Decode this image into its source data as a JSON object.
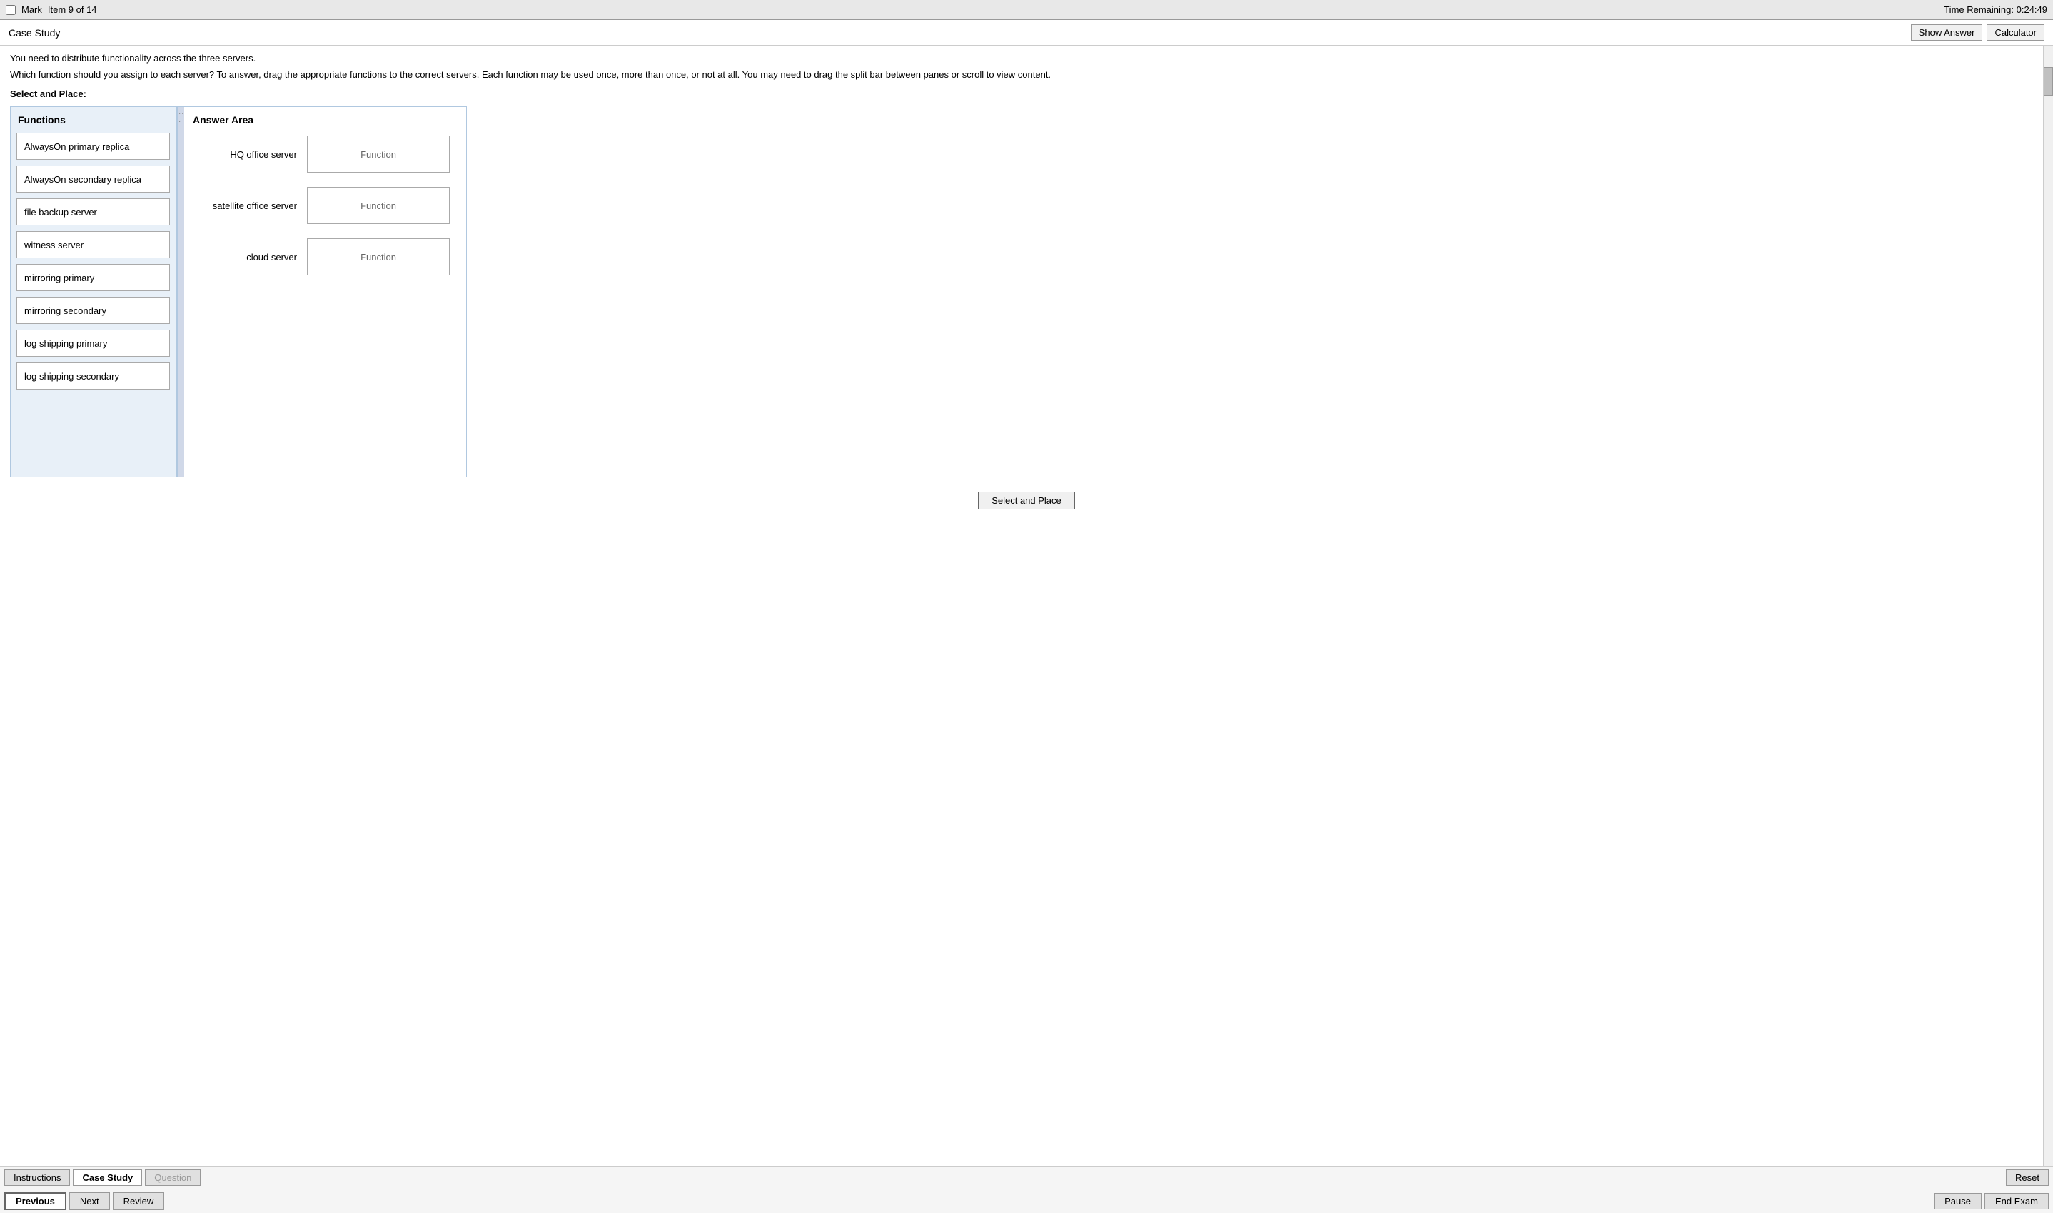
{
  "topBar": {
    "markLabel": "Mark",
    "itemInfo": "Item 9 of 14",
    "timeLabel": "Time Remaining:",
    "timeValue": "0:24:49"
  },
  "header": {
    "caseStudyLabel": "Case Study",
    "showAnswerLabel": "Show Answer",
    "calculatorLabel": "Calculator"
  },
  "instructions": {
    "text1": "You need to distribute functionality across the three servers.",
    "text2": "Which function should you assign to each server? To answer, drag the appropriate functions to the correct servers. Each function may be used once, more than once, or not at all. You may need to drag the split bar between panes or scroll to view content.",
    "selectPlaceLabel": "Select and Place:"
  },
  "functions": {
    "title": "Functions",
    "items": [
      "AlwaysOn primary replica",
      "AlwaysOn secondary replica",
      "file backup server",
      "witness server",
      "mirroring primary",
      "mirroring secondary",
      "log shipping primary",
      "log shipping secondary"
    ]
  },
  "answerArea": {
    "title": "Answer Area",
    "rows": [
      {
        "label": "HQ office server",
        "placeholder": "Function"
      },
      {
        "label": "satellite office server",
        "placeholder": "Function"
      },
      {
        "label": "cloud server",
        "placeholder": "Function"
      }
    ]
  },
  "selectPlaceBtn": "Select and Place",
  "tabs": {
    "instructions": "Instructions",
    "caseStudy": "Case Study",
    "question": "Question",
    "reset": "Reset"
  },
  "nav": {
    "previous": "Previous",
    "next": "Next",
    "review": "Review",
    "pause": "Pause",
    "endExam": "End Exam"
  }
}
